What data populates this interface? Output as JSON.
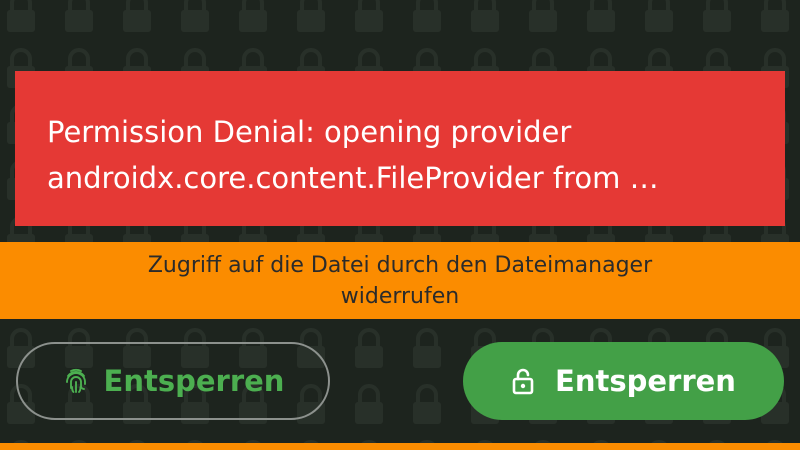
{
  "error_banner": {
    "message_line1": "Permission Denial: opening provider",
    "message_line2": "androidx.core.content.FileProvider from …",
    "color": "#e53935"
  },
  "info_bar": {
    "text": "Zugriff auf die Datei durch den Dateimanager widerrufen",
    "color": "#fb8c00"
  },
  "buttons": {
    "fingerprint_unlock": {
      "label": "Entsperren",
      "icon": "fingerprint-icon",
      "border_color": "#8c918d",
      "text_color": "#4caf50"
    },
    "unlock": {
      "label": "Entsperren",
      "icon": "lock-open-icon",
      "color": "#43a047"
    }
  },
  "background": {
    "color": "#1d241e",
    "pattern_icon": "lock-icon"
  }
}
